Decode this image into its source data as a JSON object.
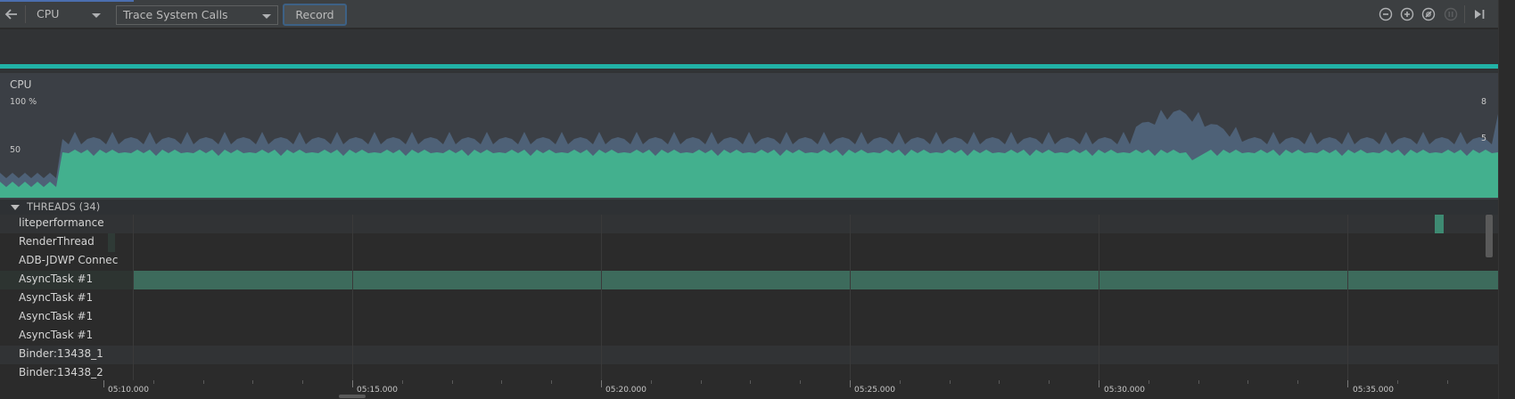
{
  "toolbar": {
    "back_icon": "arrow-left-icon",
    "profiler_select": "CPU",
    "config_select": "Trace System Calls",
    "record_label": "Record",
    "icons": [
      "zoom-out-icon",
      "zoom-in-icon",
      "reset-zoom-icon",
      "pause-icon",
      "jump-to-live-icon"
    ]
  },
  "cpu": {
    "label": "CPU",
    "axis_left_top": "100 %",
    "axis_left_mid": "50",
    "axis_right_top": "8",
    "axis_right_mid": "5",
    "colors": {
      "app_usage": "#43b08e",
      "others": "#4e6177",
      "panel_bg": "#3b3f45"
    }
  },
  "threads": {
    "header": "THREADS (34)",
    "rows": [
      {
        "name": "liteperformance"
      },
      {
        "name": "RenderThread"
      },
      {
        "name": "ADB-JDWP Connec"
      },
      {
        "name": "AsyncTask #1"
      },
      {
        "name": "AsyncTask #1"
      },
      {
        "name": "AsyncTask #1"
      },
      {
        "name": "AsyncTask #1"
      },
      {
        "name": "Binder:13438_1"
      },
      {
        "name": "Binder:13438_2"
      }
    ]
  },
  "timeline": {
    "ticks": [
      "05:10.000",
      "05:15.000",
      "05:20.000",
      "05:25.000",
      "05:30.000",
      "05:35.000"
    ]
  }
}
